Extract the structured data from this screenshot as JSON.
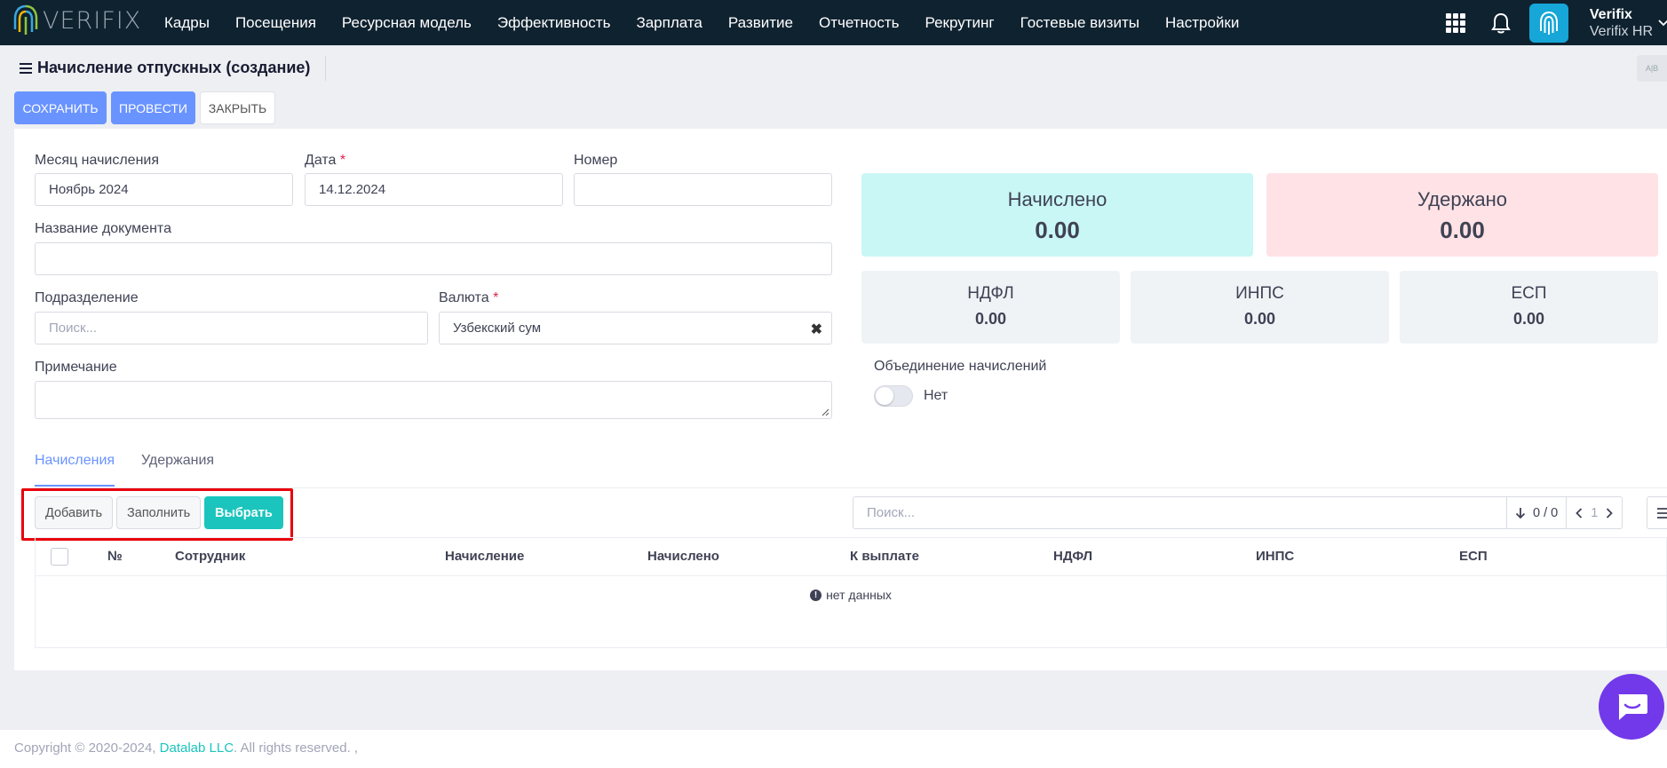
{
  "brand": {
    "logo_text": "VERIFIX"
  },
  "nav": {
    "items": [
      {
        "label": "Кадры"
      },
      {
        "label": "Посещения"
      },
      {
        "label": "Ресурсная модель"
      },
      {
        "label": "Эффективность"
      },
      {
        "label": "Зарплата"
      },
      {
        "label": "Развитие"
      },
      {
        "label": "Отчетность"
      },
      {
        "label": "Рекрутинг"
      },
      {
        "label": "Гостевые визиты"
      },
      {
        "label": "Настройки"
      }
    ]
  },
  "user": {
    "name": "Verifix",
    "org": "Verifix HR"
  },
  "page": {
    "title": "Начисление отпускных (создание)"
  },
  "actions": {
    "save": "СОХРАНИТЬ",
    "post": "ПРОВЕСТИ",
    "close": "ЗАКРЫТЬ"
  },
  "form": {
    "month": {
      "label": "Месяц начисления",
      "value": "Ноябрь 2024"
    },
    "date": {
      "label": "Дата",
      "required_mark": "*",
      "value": "14.12.2024"
    },
    "number": {
      "label": "Номер",
      "value": ""
    },
    "doc_name": {
      "label": "Название документа",
      "value": ""
    },
    "division": {
      "label": "Подразделение",
      "placeholder": "Поиск..."
    },
    "currency": {
      "label": "Валюта",
      "required_mark": "*",
      "value": "Узбекский сум"
    },
    "note": {
      "label": "Примечание",
      "value": ""
    }
  },
  "summary": {
    "accrued": {
      "label": "Начислено",
      "value": "0.00"
    },
    "withheld": {
      "label": "Удержано",
      "value": "0.00"
    },
    "ndfl": {
      "label": "НДФЛ",
      "value": "0.00"
    },
    "inps": {
      "label": "ИНПС",
      "value": "0.00"
    },
    "esp": {
      "label": "ЕСП",
      "value": "0.00"
    },
    "merge": {
      "label": "Объединение начислений",
      "state": "Нет"
    }
  },
  "tabs": [
    {
      "label": "Начисления",
      "active": true
    },
    {
      "label": "Удержания",
      "active": false
    }
  ],
  "table_toolbar": {
    "add": "Добавить",
    "fill": "Заполнить",
    "select": "Выбрать",
    "search_placeholder": "Поиск...",
    "count": "0 / 0",
    "page": "1"
  },
  "table": {
    "columns": [
      "№",
      "Сотрудник",
      "Начисление",
      "Начислено",
      "К выплате",
      "НДФЛ",
      "ИНПС",
      "ЕСП"
    ],
    "empty_text": "нет данных"
  },
  "footer": {
    "prefix": "Copyright © 2020-2024, ",
    "company": "Datalab LLC",
    "suffix": ". All rights reserved. ,"
  },
  "colors": {
    "topbar": "#0f2230",
    "primary": "#6993ff",
    "teal": "#1bc5bd",
    "accrued_bg": "#c9f7f5",
    "withheld_bg": "#ffe2e5",
    "highlight": "#e8000b",
    "chat": "#7239ea"
  }
}
